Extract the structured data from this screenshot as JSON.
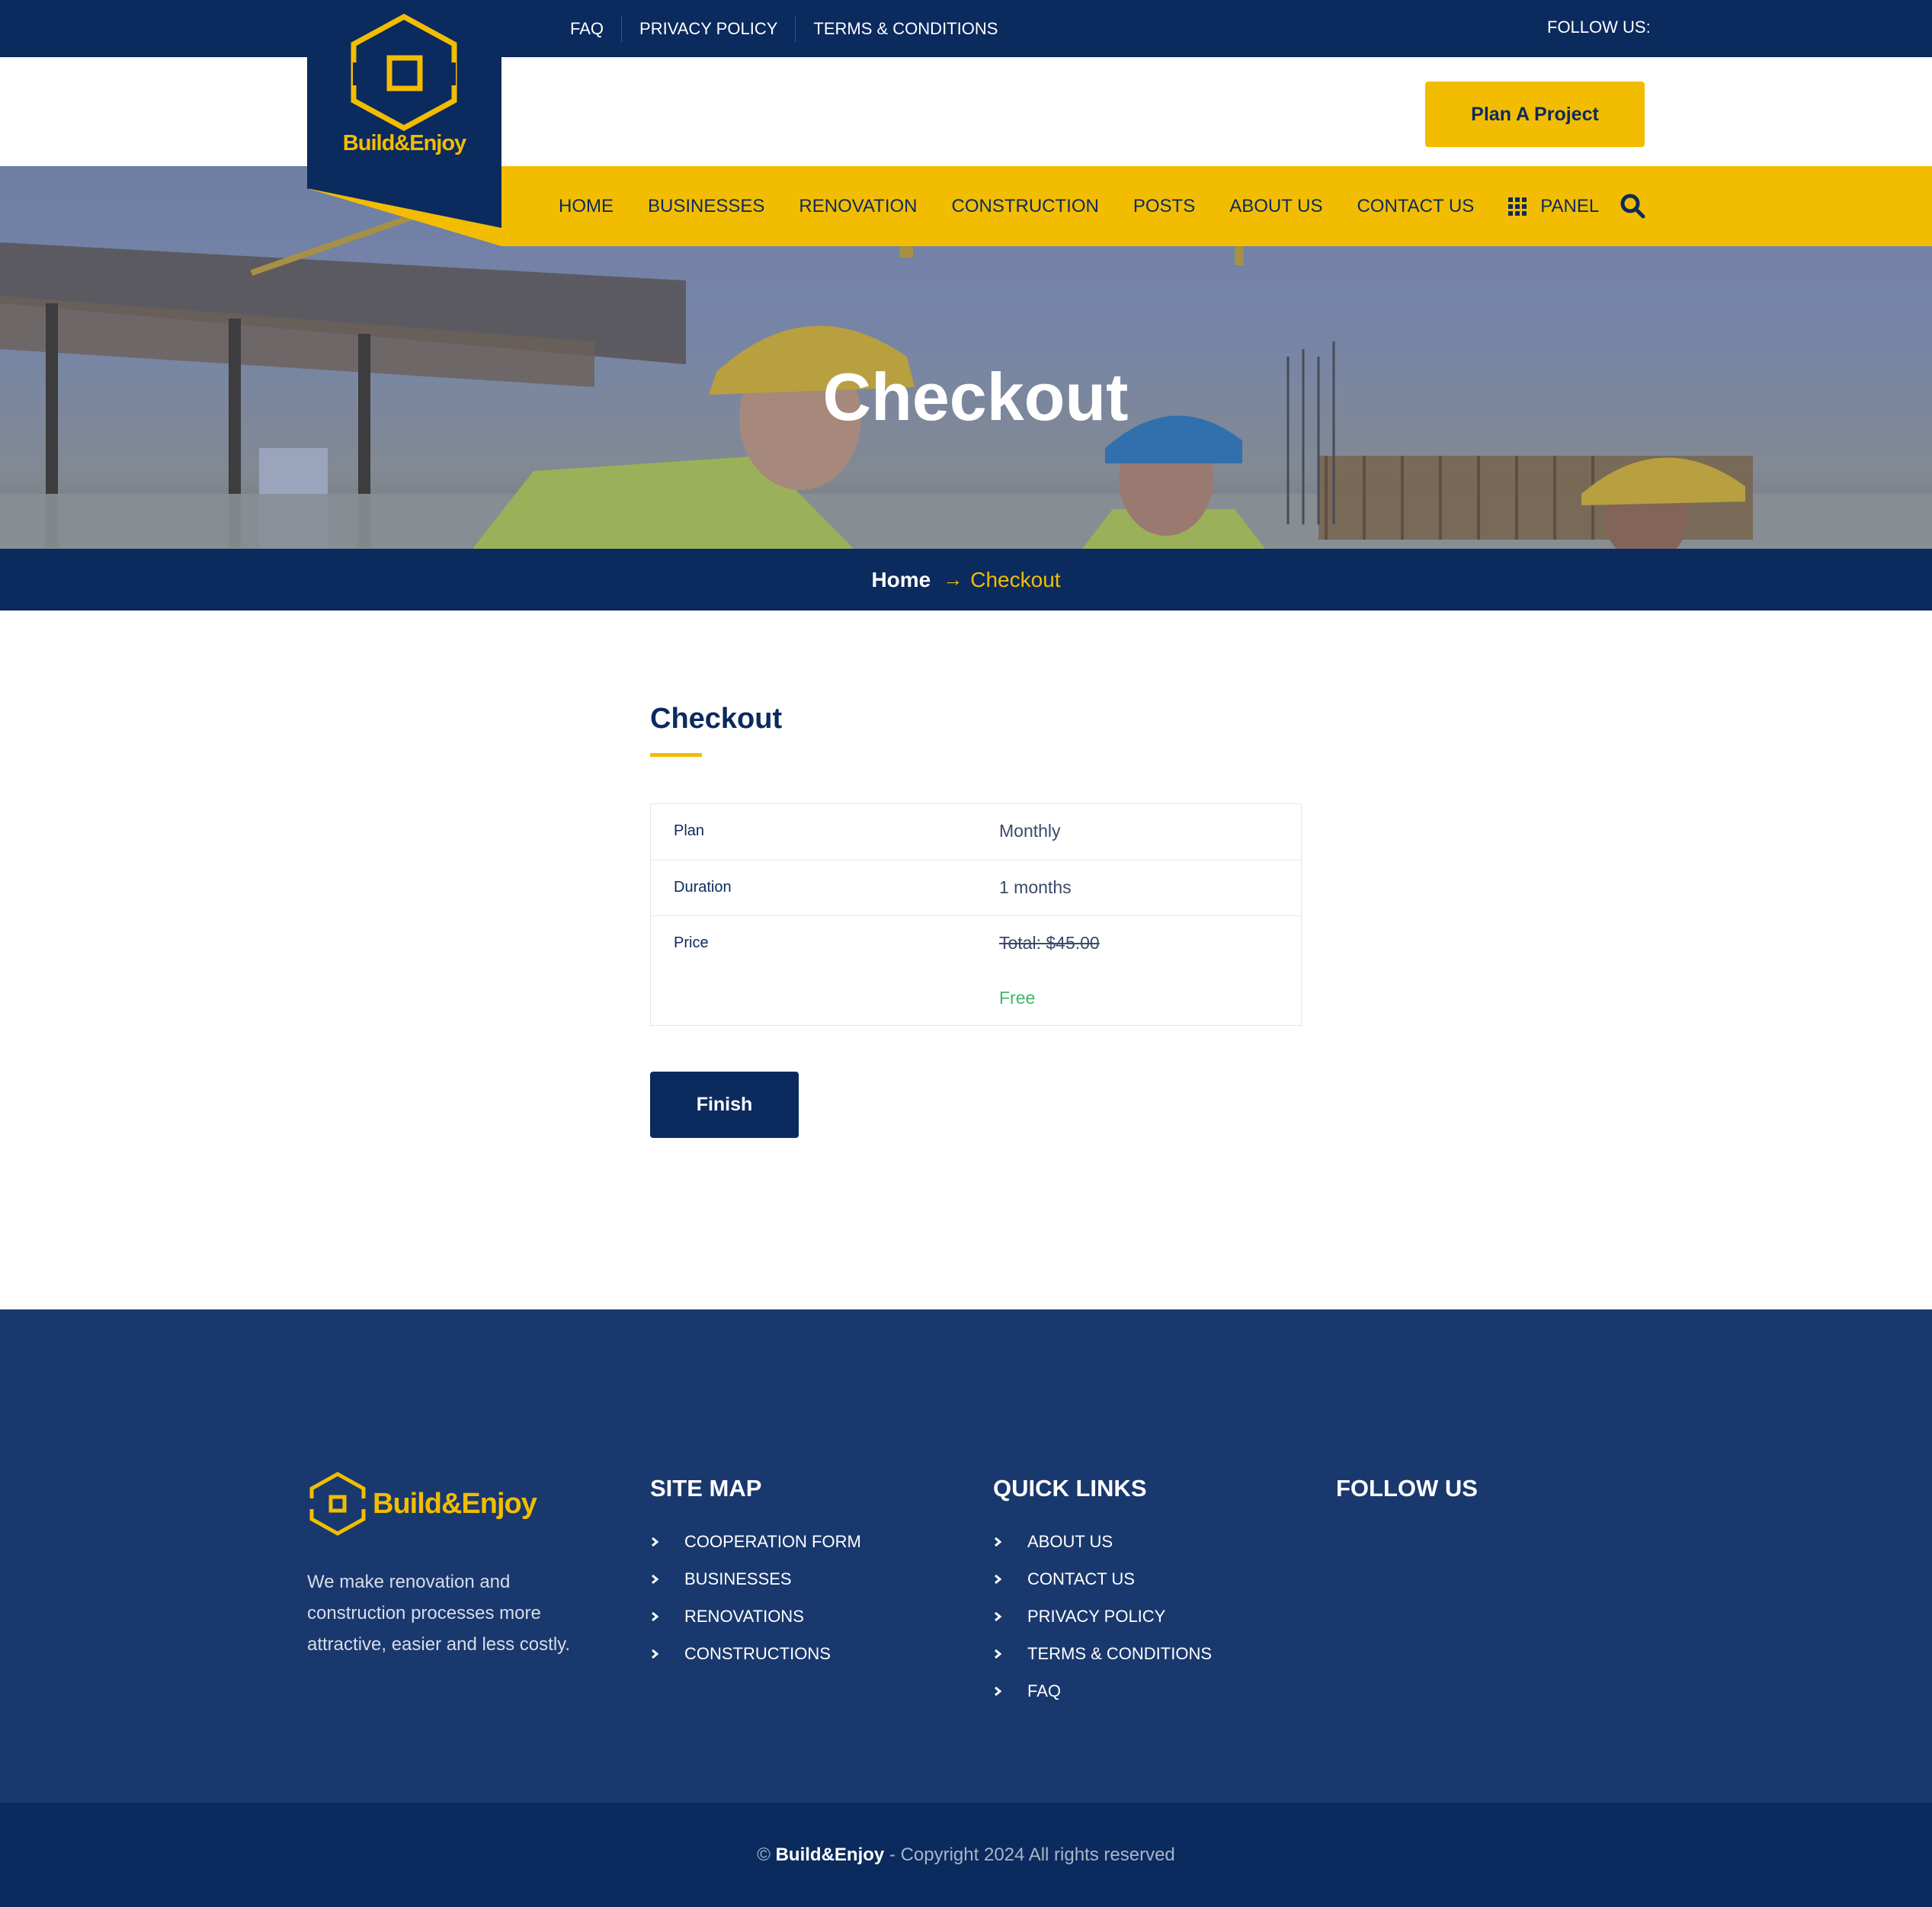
{
  "topbar": {
    "links": [
      "FAQ",
      "PRIVACY POLICY",
      "TERMS & CONDITIONS"
    ],
    "follow_label": "FOLLOW US:"
  },
  "brand": {
    "name": "Build&Enjoy",
    "accent_color": "#f2bd00",
    "primary_color": "#0b2a5e"
  },
  "header": {
    "cta_label": "Plan A Project"
  },
  "nav": {
    "items": [
      "HOME",
      "BUSINESSES",
      "RENOVATION",
      "CONSTRUCTION",
      "POSTS",
      "ABOUT US",
      "CONTACT US"
    ],
    "panel_label": "PANEL",
    "panel_icon": "grid-icon",
    "search_icon": "search-icon"
  },
  "hero": {
    "title": "Checkout"
  },
  "breadcrumb": {
    "home": "Home",
    "current": "Checkout"
  },
  "checkout": {
    "title": "Checkout",
    "rows": [
      {
        "label": "Plan",
        "value": "Monthly"
      },
      {
        "label": "Duration",
        "value": "1 months"
      },
      {
        "label": "Price",
        "value": "Total: $45.00",
        "discounted": "Free"
      }
    ],
    "finish_label": "Finish"
  },
  "footer": {
    "description": "We make renovation and construction processes more attractive, easier and less costly.",
    "sitemap_title": "SITE MAP",
    "sitemap": [
      "COOPERATION FORM",
      "BUSINESSES",
      "RENOVATIONS",
      "CONSTRUCTIONS"
    ],
    "quicklinks_title": "QUICK LINKS",
    "quicklinks": [
      "ABOUT US",
      "CONTACT US",
      "PRIVACY POLICY",
      "TERMS & CONDITIONS",
      "FAQ"
    ],
    "follow_title": "FOLLOW US",
    "copyright_prefix": "©",
    "copyright_brand": "Build&Enjoy",
    "copyright_suffix": "- Copyright 2024 All rights reserved"
  }
}
